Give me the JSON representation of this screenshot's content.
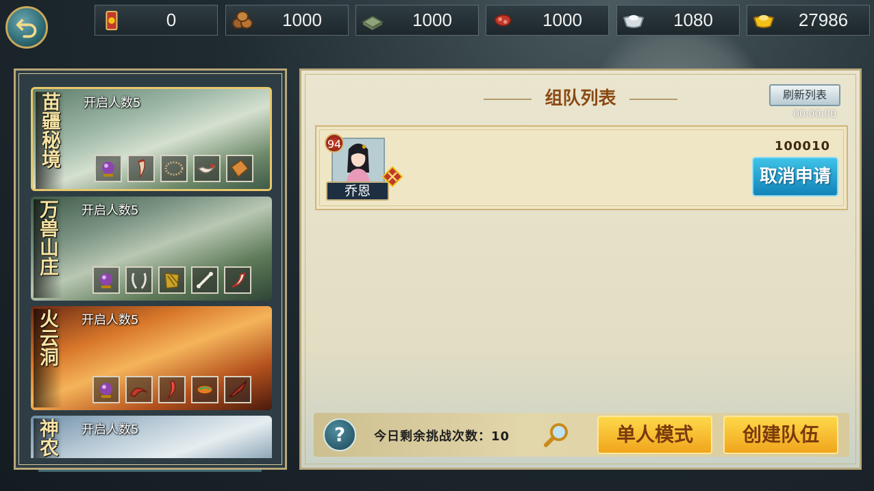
{
  "resources": [
    {
      "icon": "token-icon",
      "value": "0"
    },
    {
      "icon": "wood-icon",
      "value": "1000"
    },
    {
      "icon": "stone-icon",
      "value": "1000"
    },
    {
      "icon": "meat-icon",
      "value": "1000"
    },
    {
      "icon": "silver-ingot-icon",
      "value": "1080"
    },
    {
      "icon": "gold-ingot-icon",
      "value": "27986"
    }
  ],
  "dungeons": [
    {
      "name": "苗疆秘境",
      "caption": "开启人数5",
      "selected": true,
      "items": [
        "purple-orb-icon",
        "fang-icon",
        "necklace-icon",
        "claw-icon",
        "leather-icon"
      ]
    },
    {
      "name": "万兽山庄",
      "caption": "开启人数5",
      "selected": false,
      "items": [
        "purple-orb-icon",
        "horn-icon",
        "fur-icon",
        "bone-icon",
        "tooth-icon"
      ]
    },
    {
      "name": "火云洞",
      "caption": "开启人数5",
      "selected": false,
      "items": [
        "purple-orb-icon",
        "fire-claw-icon",
        "red-horn-icon",
        "scale-icon",
        "wing-icon"
      ]
    },
    {
      "name": "神农",
      "caption": "开启人数5",
      "selected": false,
      "items": []
    }
  ],
  "panel": {
    "title": "组队列表",
    "refresh_label": "刷新列表",
    "timer": "00:00:00"
  },
  "teams": [
    {
      "level": "94",
      "player_name": "乔恩",
      "power": "100010",
      "action_label": "取消申请"
    }
  ],
  "footer": {
    "help_label": "?",
    "remaining_text": "今日剩余挑战次数：10",
    "single_mode_label": "单人模式",
    "create_team_label": "创建队伍"
  },
  "colors": {
    "accent_gold": "#f0a51c",
    "accent_blue": "#1283b8",
    "title_brown": "#8a4a14"
  }
}
